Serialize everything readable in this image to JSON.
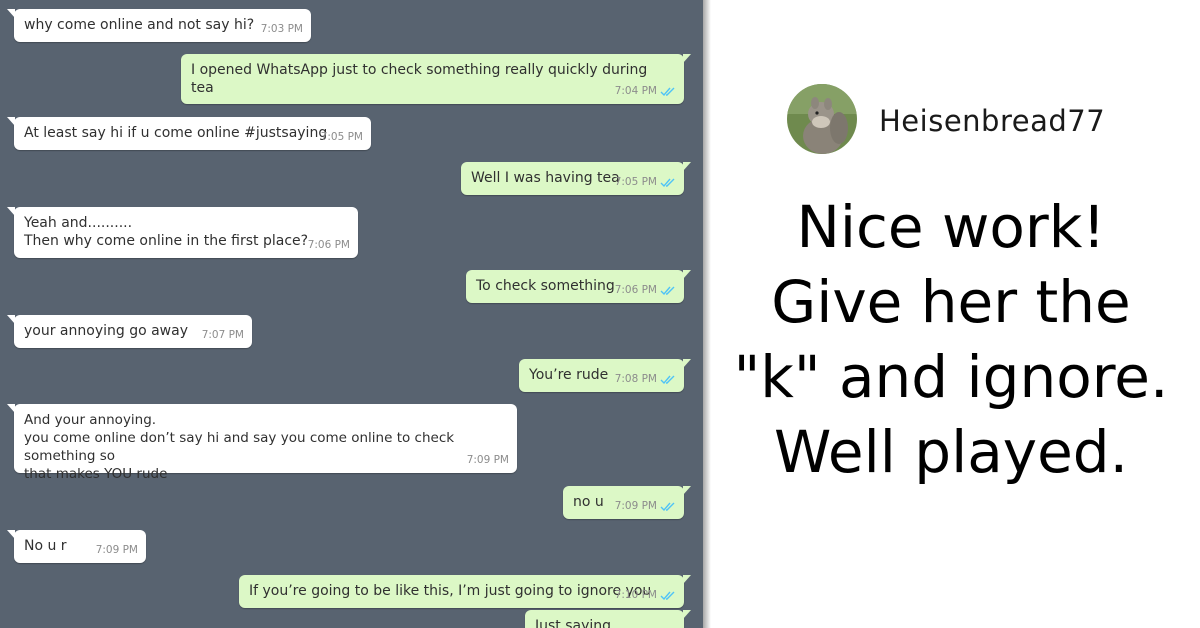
{
  "chat": {
    "background": "#586370",
    "incoming_color": "#ffffff",
    "outgoing_color": "#dcf8c6",
    "tick_color": "#4fc3f7",
    "messages": [
      {
        "dir": "in",
        "text": "why come online and not say hi?",
        "time": "7:03 PM"
      },
      {
        "dir": "out",
        "text": "I opened WhatsApp just to check something really quickly during tea",
        "time": "7:04 PM"
      },
      {
        "dir": "in",
        "text": "At least say hi if u come online #justsaying",
        "time": "7:05 PM"
      },
      {
        "dir": "out",
        "text": "Well I was having tea",
        "time": "7:05 PM"
      },
      {
        "dir": "in",
        "text": "Yeah and..........\nThen why come online in the first place?",
        "time": "7:06 PM"
      },
      {
        "dir": "out",
        "text": "To check something",
        "time": "7:06 PM"
      },
      {
        "dir": "in",
        "text": "your annoying go away",
        "time": "7:07 PM"
      },
      {
        "dir": "out",
        "text": "You’re rude",
        "time": "7:08 PM"
      },
      {
        "dir": "in",
        "text": "And your annoying.\nyou come online don’t say hi and say you come online to check something so\nthat makes YOU rude",
        "time": "7:09 PM"
      },
      {
        "dir": "out",
        "text": "no u",
        "time": "7:09 PM"
      },
      {
        "dir": "in",
        "text": "No u r",
        "time": "7:09 PM"
      },
      {
        "dir": "out",
        "text": "If you’re going to be like this, I’m just going to ignore you",
        "time": "7:10 PM"
      },
      {
        "dir": "out",
        "text": "Just saying",
        "time": ""
      }
    ]
  },
  "comment_card": {
    "username": "Heisenbread77",
    "comment": "Nice work! Give her the \"k\" and ignore. Well played.",
    "avatar_icon": "squirrel-avatar-icon"
  }
}
